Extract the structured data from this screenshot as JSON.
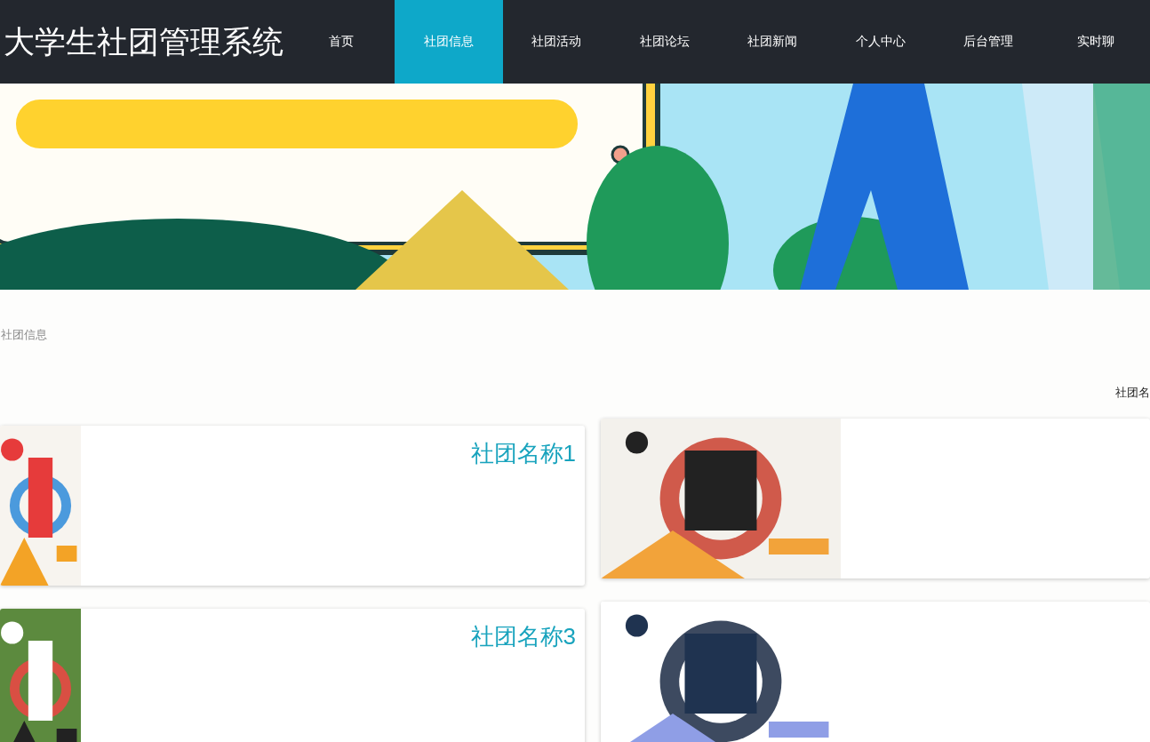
{
  "header": {
    "title": "大学生社团管理系统"
  },
  "nav": [
    {
      "label": "首页",
      "selected": false
    },
    {
      "label": "社团信息",
      "selected": true
    },
    {
      "label": "社团活动",
      "selected": false
    },
    {
      "label": "社团论坛",
      "selected": false
    },
    {
      "label": "社团新闻",
      "selected": false
    },
    {
      "label": "个人中心",
      "selected": false
    },
    {
      "label": "后台管理",
      "selected": false
    },
    {
      "label": "实时聊",
      "selected": false
    }
  ],
  "breadcrumb": "社团信息",
  "sort_label": "社团名",
  "clubs": [
    {
      "kind": "narrow",
      "title": "社团名称1"
    },
    {
      "kind": "wide"
    },
    {
      "kind": "narrow",
      "title": "社团名称3"
    },
    {
      "kind": "wide"
    }
  ]
}
